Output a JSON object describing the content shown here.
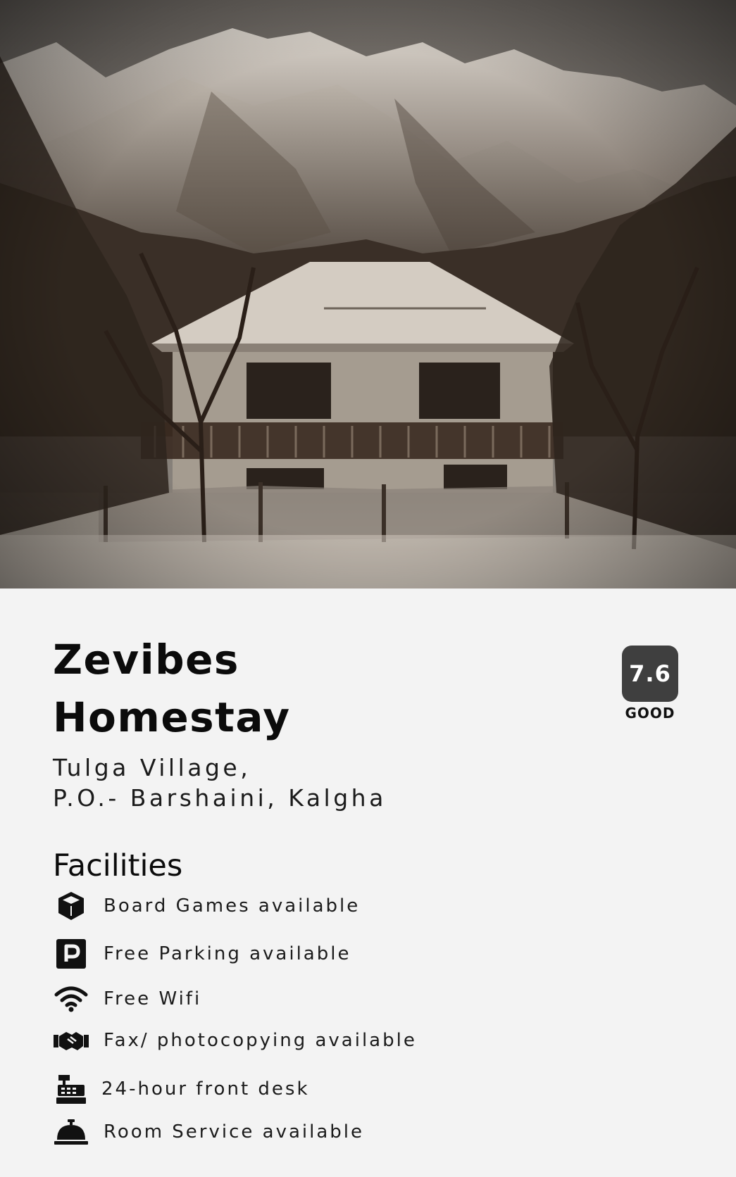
{
  "hero": {
    "image": "snowy-mountain-homestay-photo"
  },
  "property": {
    "name_line1": "Zevibes",
    "name_line2": "Homestay",
    "address_line1": "Tulga Village,",
    "address_line2": "P.O.- Barshaini, Kalgha"
  },
  "rating": {
    "score": "7.6",
    "label": "GOOD",
    "color": "#3f3f3f"
  },
  "facilities": {
    "heading": "Facilities",
    "items": [
      {
        "label": "Board Games available",
        "icon": "cube-icon"
      },
      {
        "label": "Free Parking available",
        "icon": "parking-icon"
      },
      {
        "label": "Free Wifi",
        "icon": "wifi-icon"
      },
      {
        "label": "Fax/ photocopying available",
        "icon": "handshake-icon"
      },
      {
        "label": "24-hour front desk",
        "icon": "cash-register-icon"
      },
      {
        "label": "Room Service available",
        "icon": "service-bell-icon"
      }
    ]
  }
}
